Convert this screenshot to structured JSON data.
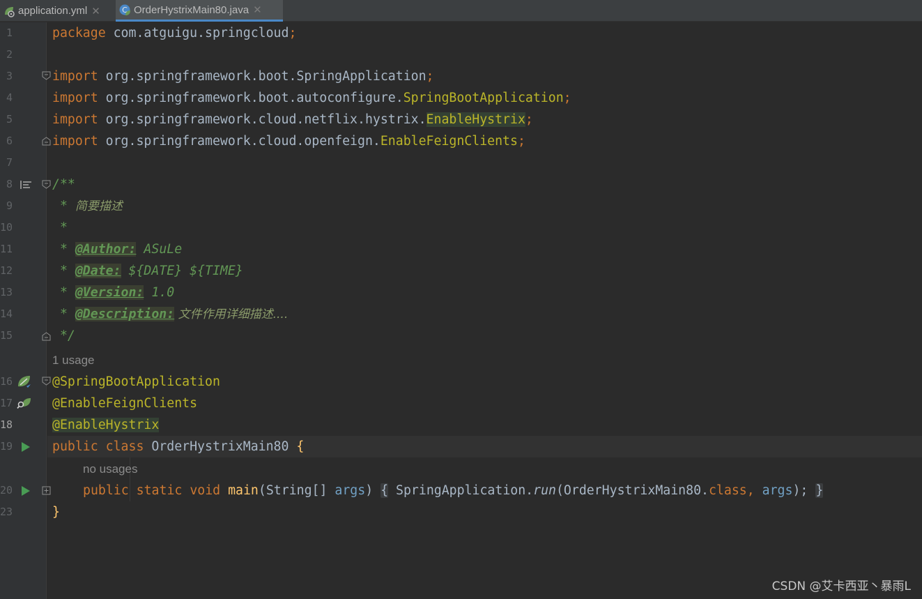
{
  "tabs": [
    {
      "name": "application.yml",
      "active": false
    },
    {
      "name": "OrderHystrixMain80.java",
      "active": true
    }
  ],
  "line_numbers": [
    "1",
    "2",
    "3",
    "4",
    "5",
    "6",
    "7",
    "8",
    "9",
    "10",
    "11",
    "12",
    "13",
    "14",
    "15",
    "16",
    "17",
    "18",
    "19",
    "20",
    "23"
  ],
  "code": {
    "kw_package": "package",
    "pkg_name": " com.atguigu.springcloud",
    "semicolon": ";",
    "kw_import": "import",
    "imp1_path": " org.springframework.boot.SpringApplication",
    "imp2_path": " org.springframework.boot.autoconfigure.",
    "imp2_cls": "SpringBootApplication",
    "imp3_path": " org.springframework.cloud.netflix.hystrix.",
    "imp3_cls": "EnableHystrix",
    "imp4_path": " org.springframework.cloud.openfeign.",
    "imp4_cls": "EnableFeignClients",
    "doc_open": "/**",
    "doc_star": " * ",
    "doc_summary": "简要描述",
    "doc_empty": " *",
    "tag_author": "@Author:",
    "val_author": " ASuLe",
    "tag_date": "@Date:",
    "val_date": " ${DATE} ${TIME}",
    "tag_version": "@Version:",
    "val_version": " 1.0",
    "tag_desc": "@Description:",
    "val_desc": " 文件作用详细描述....",
    "doc_close": " */",
    "ann1": "@SpringBootApplication",
    "ann2": "@EnableFeignClients",
    "ann3": "@EnableHystrix",
    "kw_public": "public",
    "kw_class": "class",
    "kw_static": "static",
    "kw_void": "void",
    "class_name": " OrderHystrixMain80 ",
    "brace_open": "{",
    "brace_close": "}",
    "main_name": "main",
    "main_params_pre": "(String[] ",
    "args": "args",
    "paren_close": ")",
    "body_cls": "SpringApplication.",
    "body_run": "run",
    "body_arg1": "(OrderHystrixMain80.",
    "kw_class_lit": "class",
    "comma": ", ",
    "body_end": ");"
  },
  "hints": {
    "class_usage": "1 usage",
    "method_usage": "no usages"
  },
  "watermark": "CSDN @艾卡西亚丶暴雨L",
  "colors": {
    "keyword": "#cc7832",
    "annotation": "#bbb529",
    "comment": "#629755",
    "method": "#ffc66d",
    "param": "#72a2c6",
    "text": "#a9b7c6",
    "background": "#2b2b2b"
  },
  "icons": {
    "yml_tab": "spring-leaf-gear-icon",
    "java_tab": "spring-class-icon",
    "line8": "doc-render-toggle-icon",
    "line16": "spring-bean-icon",
    "line17": "spring-bean-search-icon",
    "line19": "run-gutter-icon",
    "line20": "run-gutter-icon"
  }
}
